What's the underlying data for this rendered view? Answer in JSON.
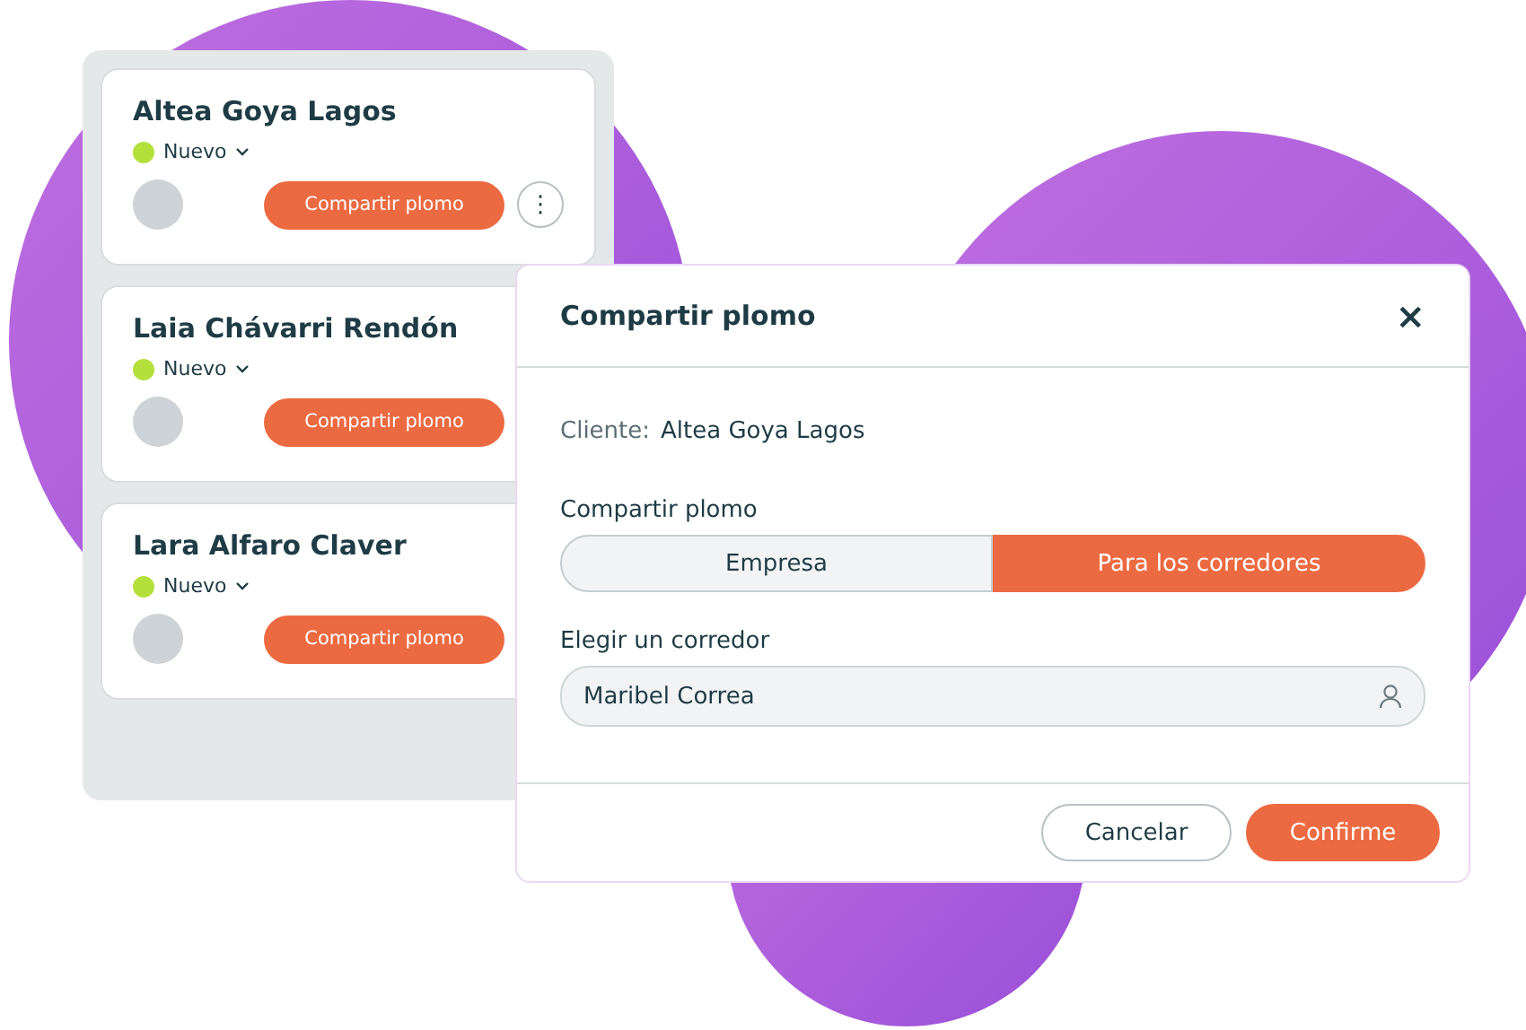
{
  "leads": [
    {
      "name": "Altea Goya Lagos",
      "status": "Nuevo",
      "share_button": "Compartir plomo",
      "menu_icon": "⋮"
    },
    {
      "name": "Laia Chávarri Rendón",
      "status": "Nuevo",
      "share_button": "Compartir plomo"
    },
    {
      "name": "Lara Alfaro Claver",
      "status": "Nuevo",
      "share_button": "Compartir plomo"
    }
  ],
  "dialog": {
    "title": "Compartir plomo",
    "close": "×",
    "client_label": "Cliente:",
    "client_name": "Altea Goya Lagos",
    "share_label": "Compartir plomo",
    "share_options": [
      {
        "label": "Empresa",
        "selected": false
      },
      {
        "label": "Para los corredores",
        "selected": true
      }
    ],
    "broker_label": "Elegir un corredor",
    "broker_value": "Maribel Correa",
    "buttons": [
      {
        "label": "Cancelar",
        "kind": "secondary"
      },
      {
        "label": "Confirme",
        "kind": "primary"
      }
    ]
  }
}
